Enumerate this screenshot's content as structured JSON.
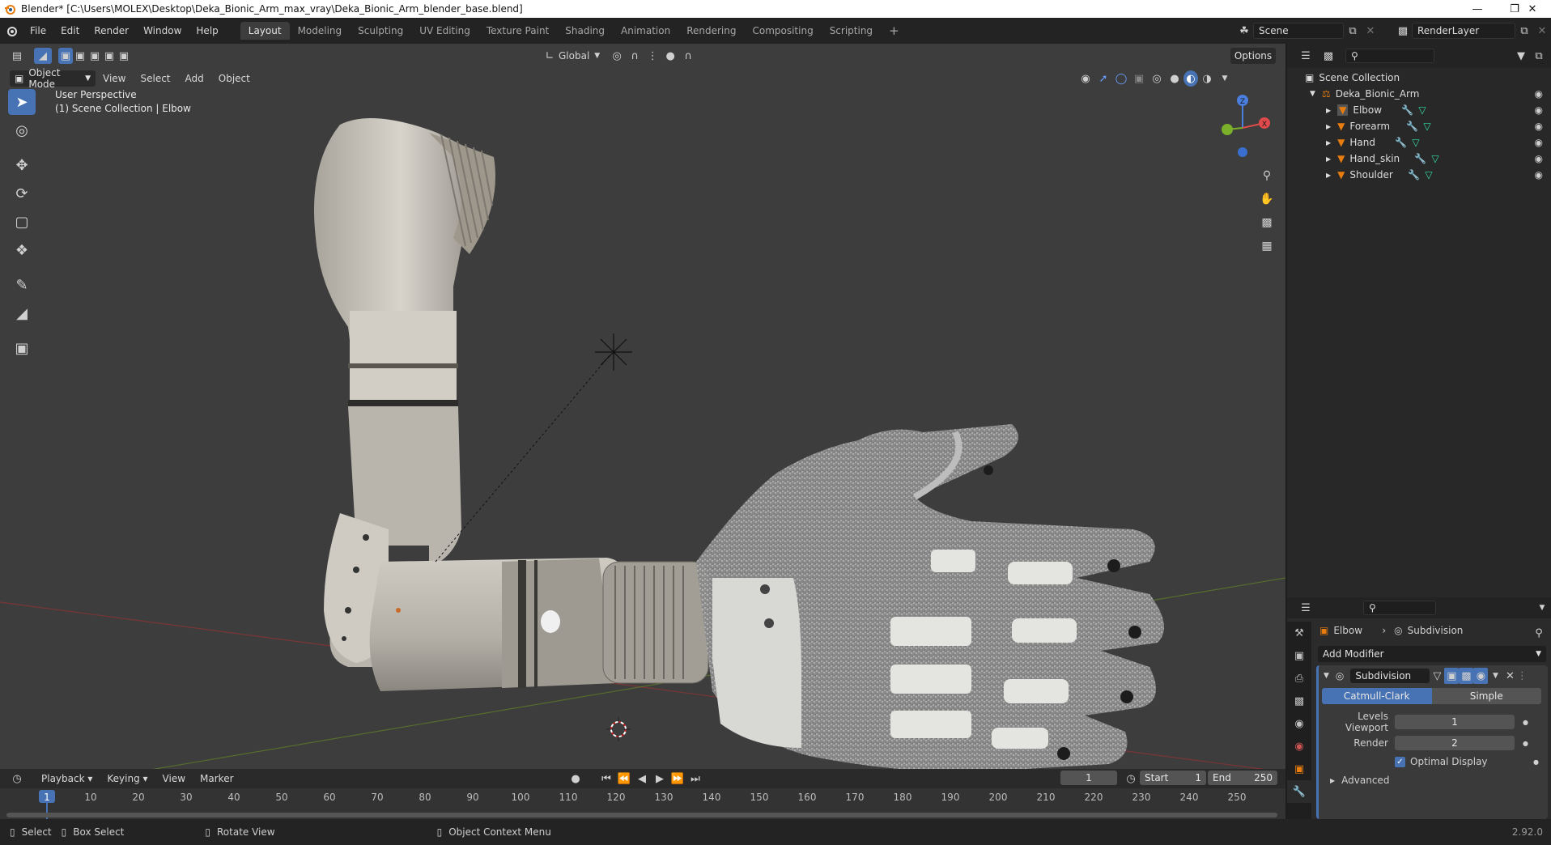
{
  "window": {
    "title": "Blender* [C:\\Users\\MOLEX\\Desktop\\Deka_Bionic_Arm_max_vray\\Deka_Bionic_Arm_blender_base.blend]",
    "minimize_icon": "minimize-icon",
    "maximize_icon": "restore-icon",
    "close_icon": "close-icon"
  },
  "menu": {
    "items": [
      "File",
      "Edit",
      "Render",
      "Window",
      "Help"
    ]
  },
  "workspaces": {
    "tabs": [
      "Layout",
      "Modeling",
      "Sculpting",
      "UV Editing",
      "Texture Paint",
      "Shading",
      "Animation",
      "Rendering",
      "Compositing",
      "Scripting"
    ],
    "active": "Layout",
    "add_icon": "plus-icon"
  },
  "scene": {
    "scene_name": "Scene",
    "view_layer": "RenderLayer"
  },
  "viewport": {
    "transform_orientation": "Global",
    "options_label": "Options",
    "mode": "Object Mode",
    "header_menus": [
      "View",
      "Select",
      "Add",
      "Object"
    ],
    "overlay_title": "User Perspective",
    "overlay_subtitle": "(1) Scene Collection | Elbow",
    "gizmo_axes": [
      "X",
      "Y",
      "Z"
    ],
    "tools": [
      "select-box-icon",
      "cursor-icon",
      "move-icon",
      "rotate-icon",
      "scale-icon",
      "transform-icon",
      "annotate-icon",
      "measure-icon",
      "add-cube-icon"
    ],
    "nav_icons": [
      "zoom-icon",
      "pan-hand-icon",
      "camera-icon",
      "grid-ortho-icon"
    ]
  },
  "outliner": {
    "root": "Scene Collection",
    "collection": "Deka_Bionic_Arm",
    "objects": [
      "Elbow",
      "Forearm",
      "Hand",
      "Hand_skin",
      "Shoulder"
    ],
    "search_placeholder": ""
  },
  "properties": {
    "object": "Elbow",
    "modifier_breadcrumb": "Subdivision",
    "add_modifier": "Add Modifier",
    "modifier": {
      "name": "Subdivision",
      "mode_catmull": "Catmull-Clark",
      "mode_simple": "Simple",
      "levels_viewport_label": "Levels Viewport",
      "levels_viewport": "1",
      "render_label": "Render",
      "render": "2",
      "optimal_display": "Optimal Display",
      "advanced": "Advanced"
    }
  },
  "timeline": {
    "menus": [
      "Playback",
      "Keying",
      "View",
      "Marker"
    ],
    "current_frame": "1",
    "start_label": "Start",
    "start": "1",
    "end_label": "End",
    "end": "250",
    "ticks": [
      "1",
      "10",
      "20",
      "30",
      "40",
      "50",
      "60",
      "70",
      "80",
      "90",
      "100",
      "110",
      "120",
      "130",
      "140",
      "150",
      "160",
      "170",
      "180",
      "190",
      "200",
      "210",
      "220",
      "230",
      "240",
      "250"
    ]
  },
  "statusbar": {
    "select": "Select",
    "box_select": "Box Select",
    "rotate_view": "Rotate View",
    "context_menu": "Object Context Menu",
    "version": "2.92.0"
  },
  "colors": {
    "accent": "#4772b3",
    "orange": "#e87d0d",
    "viewport_bg": "#3d3d3d"
  }
}
